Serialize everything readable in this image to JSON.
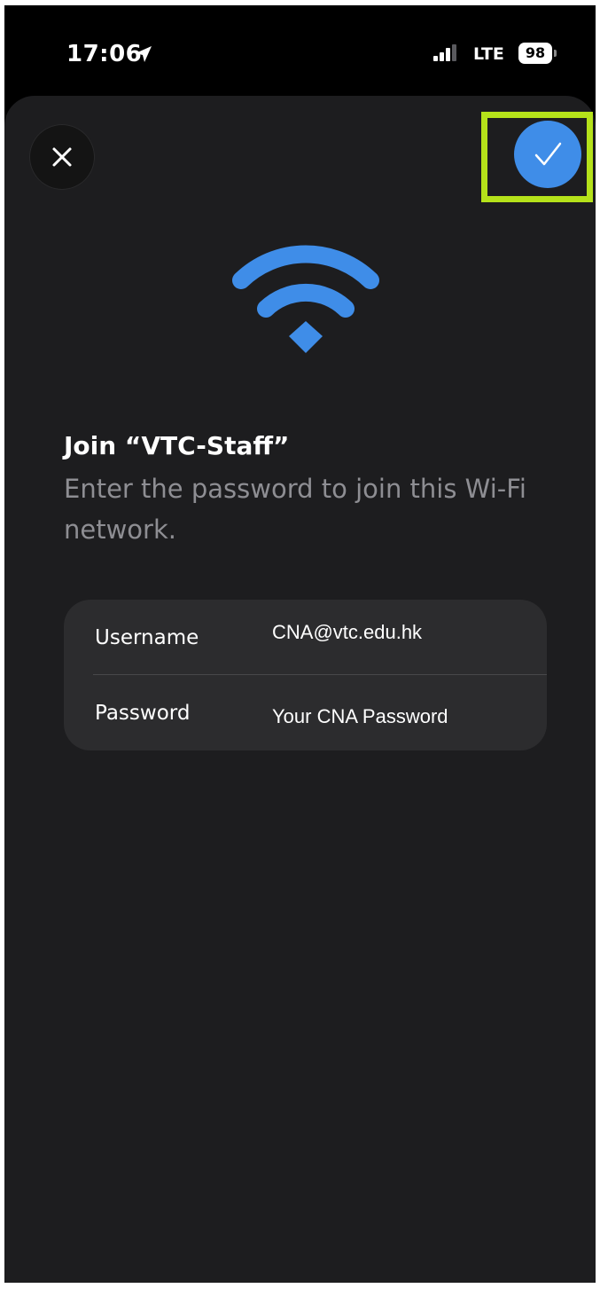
{
  "status_bar": {
    "time": "17:06",
    "location_icon": "location-arrow-icon",
    "signal_icon": "cellular-signal-icon",
    "network": "LTE",
    "battery": "98"
  },
  "sheet": {
    "close_icon": "close-x-icon",
    "confirm_icon": "checkmark-icon",
    "confirm_highlight_color": "#b5e21a",
    "accent_color": "#3f8de8",
    "wifi_icon": "wifi-icon",
    "title": "Join “VTC-Staff”",
    "subtitle": "Enter the password to join this Wi-Fi network.",
    "fields": {
      "username": {
        "label": "Username",
        "value": "CNA@vtc.edu.hk"
      },
      "password": {
        "label": "Password",
        "value": "Your CNA Password"
      }
    }
  }
}
